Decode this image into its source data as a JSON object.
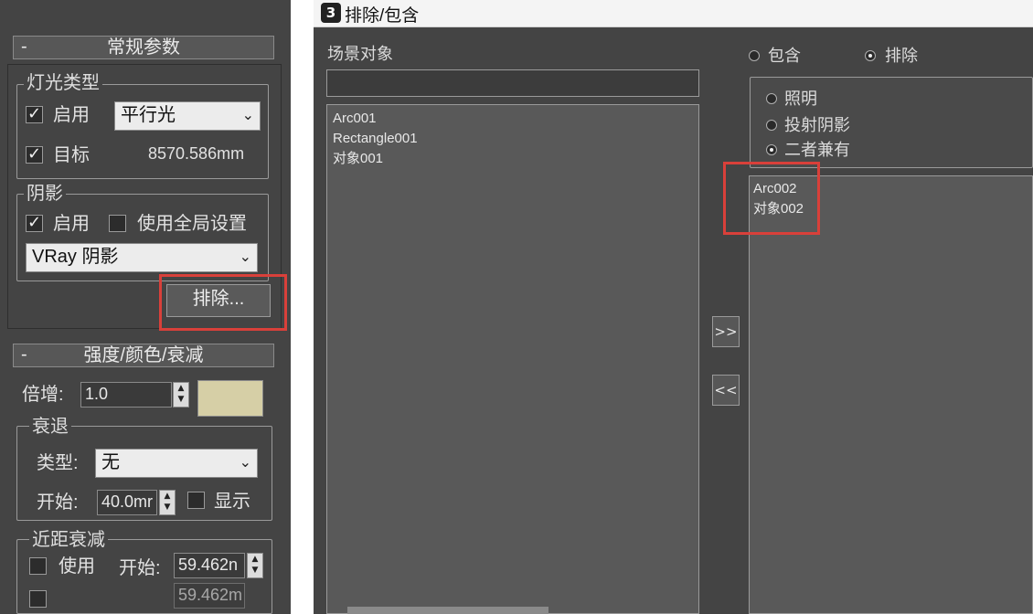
{
  "general_params": {
    "header": "常规参数",
    "collapse_symbol": "-",
    "light_type": {
      "group_label": "灯光类型",
      "enable_label": "启用",
      "enable_checked": true,
      "type_value": "平行光",
      "target_label": "目标",
      "target_checked": true,
      "target_distance": "8570.586mm"
    },
    "shadow": {
      "group_label": "阴影",
      "enable_label": "启用",
      "enable_checked": true,
      "use_global_label": "使用全局设置",
      "use_global_checked": false,
      "shadow_type": "VRay 阴影"
    },
    "exclude_button": "排除..."
  },
  "intensity": {
    "header": "强度/颜色/衰减",
    "collapse_symbol": "-",
    "multiplier_label": "倍增:",
    "multiplier_value": "1.0",
    "color_swatch": "#d6cfa6",
    "decay": {
      "group_label": "衰退",
      "type_label": "类型:",
      "type_value": "无",
      "start_label": "开始:",
      "start_value": "40.0mr",
      "show_label": "显示",
      "show_checked": false
    },
    "near_atten": {
      "group_label": "近距衰减",
      "use_label": "使用",
      "use_checked": false,
      "start_label": "开始:",
      "start_value": "59.462n",
      "end_value": "59.462m"
    }
  },
  "dialog": {
    "title": "排除/包含",
    "scene_objects_label": "场景对象",
    "scene_objects": [
      "Arc001",
      "Rectangle001",
      "对象001"
    ],
    "mode_include": "包含",
    "mode_exclude": "排除",
    "mode_selected": "exclude",
    "options": [
      {
        "label": "照明",
        "selected": false
      },
      {
        "label": "投射阴影",
        "selected": false
      },
      {
        "label": "二者兼有",
        "selected": true
      }
    ],
    "excluded_objects": [
      "Arc002",
      "对象002"
    ],
    "move_right": ">>",
    "move_left": "<<"
  },
  "colors": {
    "highlight_red": "#d9403a",
    "panel_bg": "#444444"
  }
}
